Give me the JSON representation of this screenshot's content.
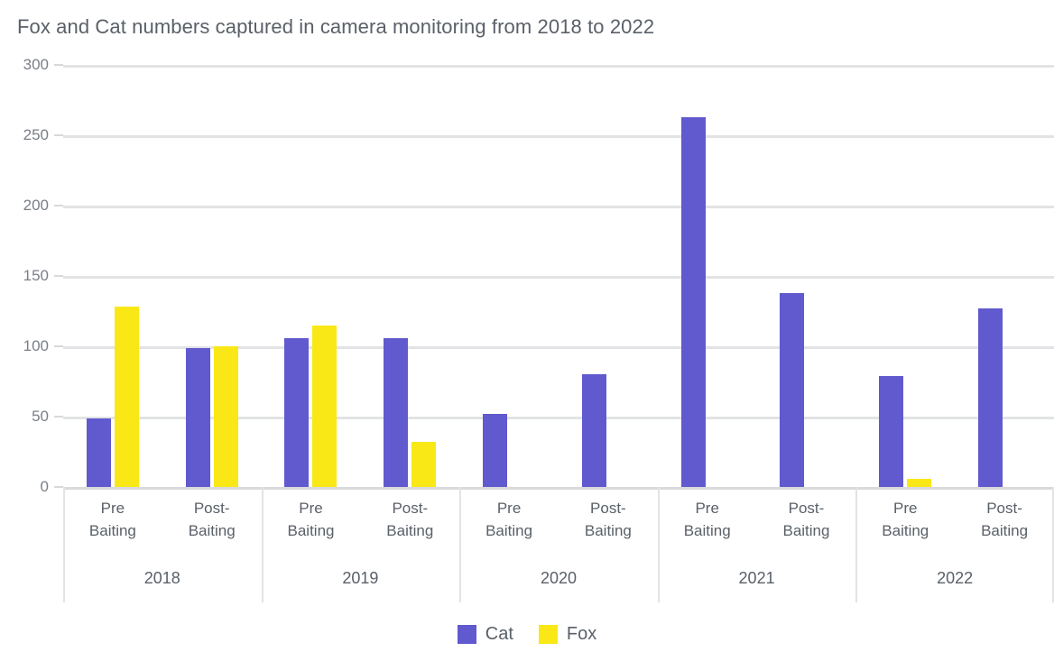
{
  "chart_data": {
    "type": "bar",
    "title": "Fox and Cat numbers captured in camera monitoring from 2018 to 2022",
    "xlabel": "",
    "ylabel": "",
    "ylim": [
      0,
      300
    ],
    "yticks": [
      0,
      50,
      100,
      150,
      200,
      250,
      300
    ],
    "ytick_labels": [
      "0",
      "50",
      "100",
      "150",
      "200",
      "250",
      "300"
    ],
    "grid": true,
    "legend_position": "bottom",
    "grouping": "year > phase",
    "years": [
      "2018",
      "2019",
      "2020",
      "2021",
      "2022"
    ],
    "phases": [
      "Pre Baiting",
      "Post-Baiting"
    ],
    "categories": [
      "2018 Pre Baiting",
      "2018 Post-Baiting",
      "2019 Pre Baiting",
      "2019 Post-Baiting",
      "2020 Pre Baiting",
      "2020 Post-Baiting",
      "2021 Pre Baiting",
      "2021 Post-Baiting",
      "2022 Pre Baiting",
      "2022 Post-Baiting"
    ],
    "series": [
      {
        "name": "Cat",
        "color": "#6159ce",
        "values": [
          49,
          99,
          106,
          106,
          52,
          80,
          263,
          138,
          79,
          127
        ]
      },
      {
        "name": "Fox",
        "color": "#fae816",
        "values": [
          128,
          100,
          115,
          32,
          null,
          null,
          null,
          null,
          6,
          null
        ]
      }
    ]
  },
  "axis": {
    "y_ticks": [
      "300",
      "250",
      "200",
      "150",
      "100",
      "50",
      "0"
    ]
  },
  "groups": [
    {
      "year": "2018",
      "phases": [
        {
          "label_line1": "Pre",
          "label_line2": "Baiting",
          "cat": 49,
          "fox": 128
        },
        {
          "label_line1": "Post-",
          "label_line2": "Baiting",
          "cat": 99,
          "fox": 100
        }
      ]
    },
    {
      "year": "2019",
      "phases": [
        {
          "label_line1": "Pre",
          "label_line2": "Baiting",
          "cat": 106,
          "fox": 115
        },
        {
          "label_line1": "Post-",
          "label_line2": "Baiting",
          "cat": 106,
          "fox": 32
        }
      ]
    },
    {
      "year": "2020",
      "phases": [
        {
          "label_line1": "Pre",
          "label_line2": "Baiting",
          "cat": 52,
          "fox": null
        },
        {
          "label_line1": "Post-",
          "label_line2": "Baiting",
          "cat": 80,
          "fox": null
        }
      ]
    },
    {
      "year": "2021",
      "phases": [
        {
          "label_line1": "Pre",
          "label_line2": "Baiting",
          "cat": 263,
          "fox": null
        },
        {
          "label_line1": "Post-",
          "label_line2": "Baiting",
          "cat": 138,
          "fox": null
        }
      ]
    },
    {
      "year": "2022",
      "phases": [
        {
          "label_line1": "Pre",
          "label_line2": "Baiting",
          "cat": 79,
          "fox": 6
        },
        {
          "label_line1": "Post-",
          "label_line2": "Baiting",
          "cat": 127,
          "fox": null
        }
      ]
    }
  ],
  "legend": {
    "items": [
      {
        "label": "Cat",
        "color": "#6159ce"
      },
      {
        "label": "Fox",
        "color": "#fae816"
      }
    ]
  },
  "colors": {
    "cat": "#6159ce",
    "fox": "#fae816",
    "title_text": "#5a6068",
    "grid": "#e2e3e5",
    "tick_text": "#7a7f86"
  }
}
